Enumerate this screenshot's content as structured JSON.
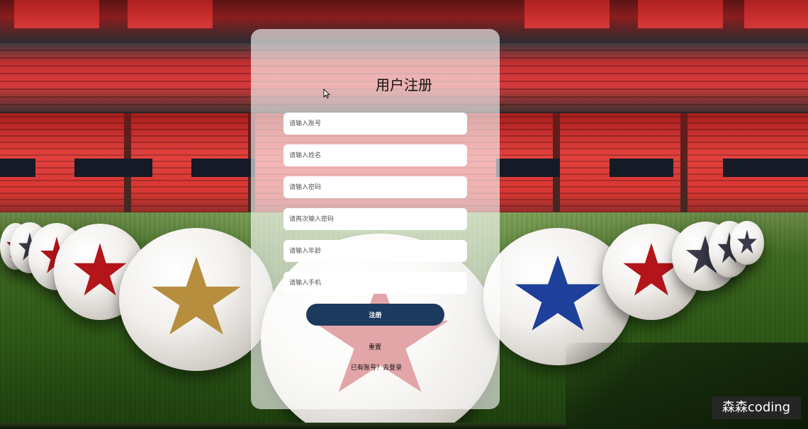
{
  "form": {
    "title": "用户注册",
    "fields": {
      "account_placeholder": "请输入账号",
      "name_placeholder": "请输入姓名",
      "password_placeholder": "请输入密码",
      "confirm_password_placeholder": "请再次输入密码",
      "age_placeholder": "请输入年龄",
      "phone_placeholder": "请输入手机"
    },
    "submit_label": "注册",
    "reset_label": "重置",
    "login_prompt": "已有账号？去登录"
  },
  "watermark": {
    "text": "森森coding"
  },
  "colors": {
    "button": "#1c3a5e",
    "panel": "rgba(255,255,255,0.62)",
    "field": "#ffffff"
  }
}
